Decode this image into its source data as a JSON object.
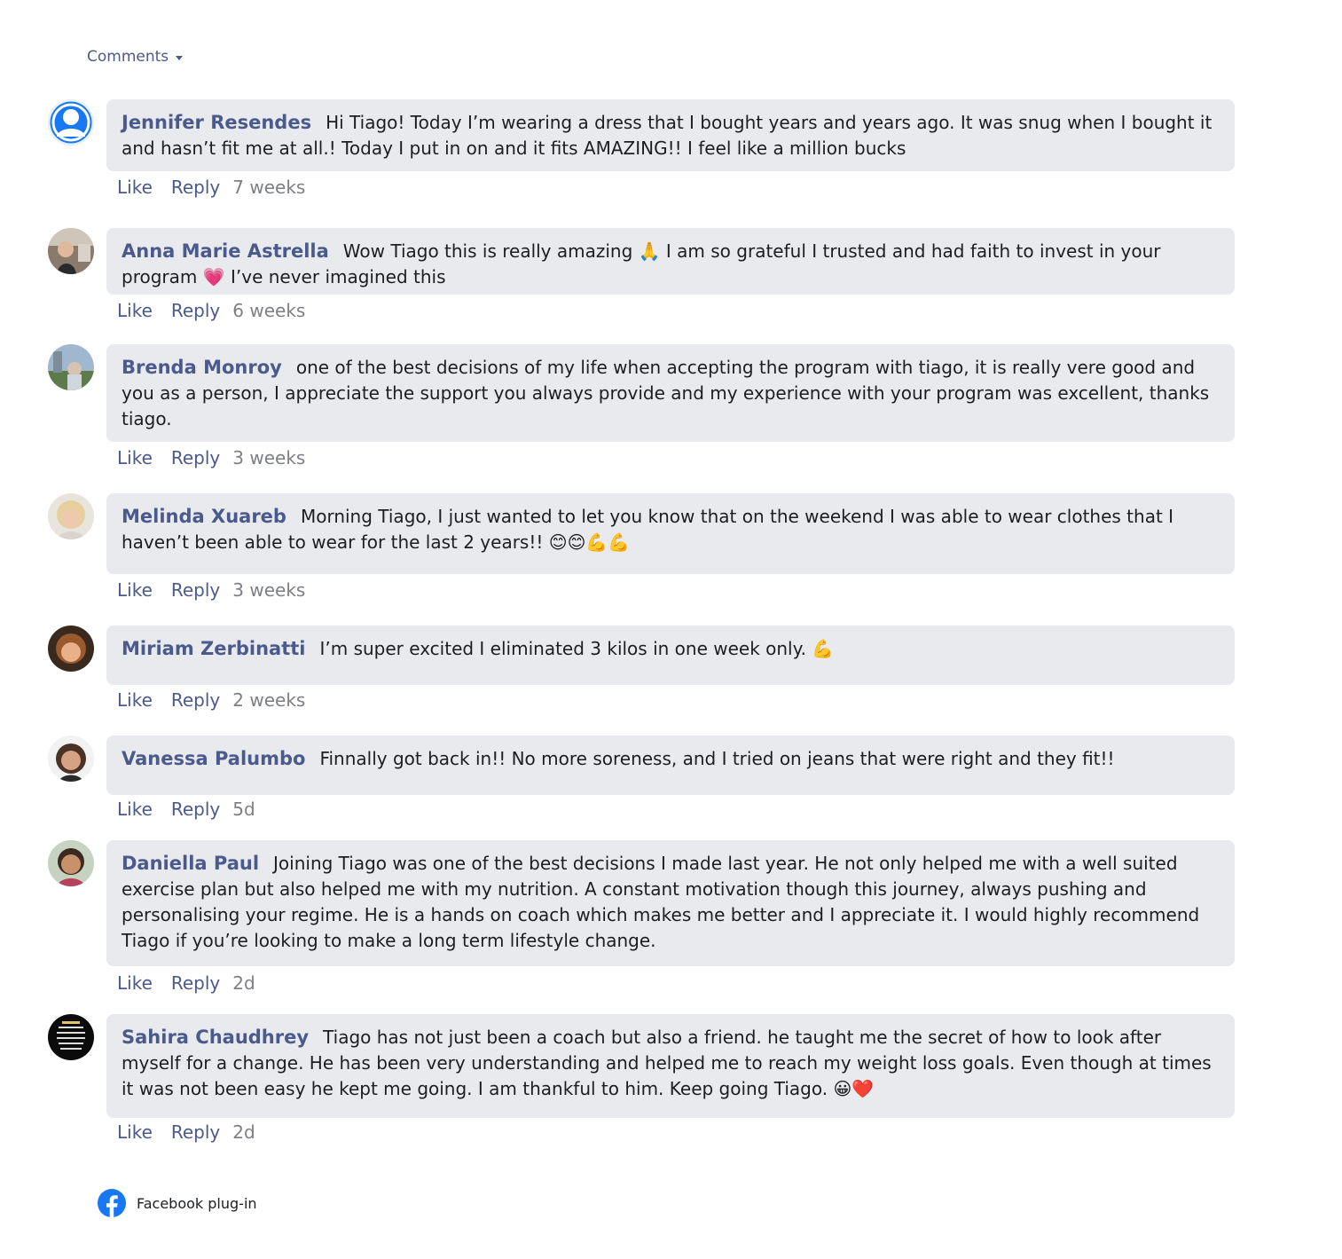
{
  "header": {
    "comments_label": "Comments"
  },
  "comments": [
    {
      "author": "Jennifer Resendes",
      "text": "Hi Tiago! Today I’m wearing a dress that I bought years and years ago. It was snug when I bought it and hasn’t fit me at all.! Today I put in on and it fits AMAZING!! I feel like a million bucks",
      "like": "Like",
      "reply": "Reply",
      "time": "7 weeks",
      "avatar": "default-user"
    },
    {
      "author": "Anna Marie Astrella",
      "text": "Wow Tiago this is really amazing 🙏 I am so grateful I trusted and had faith to invest in your program 💗 I’ve never imagined this",
      "like": "Like",
      "reply": "Reply",
      "time": "6 weeks",
      "avatar": "photo"
    },
    {
      "author": "Brenda Monroy",
      "text": "one of the best decisions of my life when accepting the program with tiago, it is really vere good and you as a person, I appreciate the support you always provide and my experience with your program was excellent, thanks tiago.",
      "like": "Like",
      "reply": "Reply",
      "time": "3 weeks",
      "avatar": "photo"
    },
    {
      "author": "Melinda Xuareb",
      "text": "Morning Tiago, I just wanted to let you know that on the weekend I was able to wear clothes that I haven’t been able to wear for the last 2 years!! 😊😊💪💪",
      "like": "Like",
      "reply": "Reply",
      "time": "3 weeks",
      "avatar": "photo"
    },
    {
      "author": "Miriam Zerbinatti",
      "text": "I’m super excited I eliminated 3 kilos in one week only. 💪",
      "like": "Like",
      "reply": "Reply",
      "time": "2 weeks",
      "avatar": "photo"
    },
    {
      "author": "Vanessa Palumbo",
      "text": "Finnally got back in!! No more soreness, and I tried on jeans that were right and they fit!!",
      "like": "Like",
      "reply": "Reply",
      "time": "5d",
      "avatar": "photo"
    },
    {
      "author": "Daniella Paul",
      "text": "Joining Tiago was one of the best decisions I made last year. He not only helped me with a well suited exercise plan but also helped me with my nutrition. A constant motivation though this journey, always pushing and personalising your regime. He is a hands on coach which makes me better and I appreciate it. I would highly recommend Tiago if you’re looking to make a long term lifestyle change.",
      "like": "Like",
      "reply": "Reply",
      "time": "2d",
      "avatar": "photo"
    },
    {
      "author": "Sahira Chaudhrey",
      "text": "Tiago has not just been a coach but also a friend. he taught me the secret of how to look after myself for a change. He has been very understanding and helped me to reach my weight loss goals. Even though at times it was not been easy he kept me going. I am thankful to him. Keep going Tiago. 😀❤️",
      "like": "Like",
      "reply": "Reply",
      "time": "2d",
      "avatar": "photo"
    }
  ],
  "footer": {
    "label": "Facebook plug-in",
    "icon": "facebook-icon"
  },
  "colors": {
    "accent": "#4b5a8c",
    "bubble": "#e9eaee",
    "fb_blue": "#1877f2"
  }
}
